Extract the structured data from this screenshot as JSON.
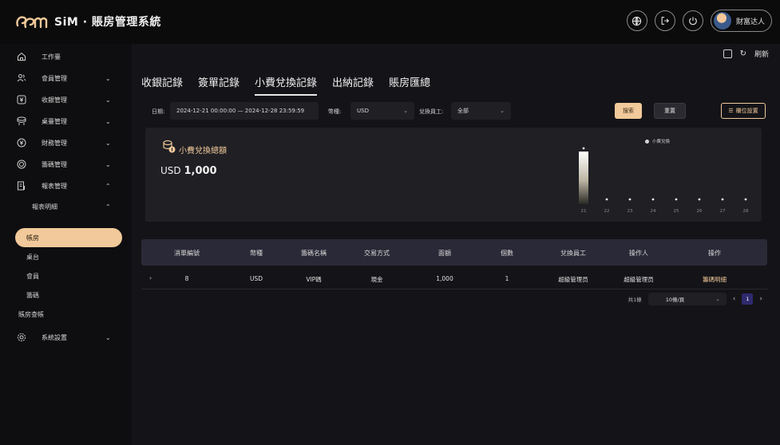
{
  "app": {
    "title": "SiM · 賬房管理系統",
    "user_name": "財富达人"
  },
  "sidebar": {
    "items": [
      {
        "label": "工作臺",
        "icon": "home-icon"
      },
      {
        "label": "會員管理",
        "icon": "user-group-icon"
      },
      {
        "label": "收銀管理",
        "icon": "cashier-icon"
      },
      {
        "label": "桌臺管理",
        "icon": "table-icon"
      },
      {
        "label": "財務管理",
        "icon": "finance-icon"
      },
      {
        "label": "籌碼管理",
        "icon": "chip-icon"
      },
      {
        "label": "報表管理",
        "icon": "report-icon"
      },
      {
        "label": "系統設置",
        "icon": "settings-icon"
      }
    ],
    "report_group": "報表明細",
    "report_subitems": [
      "帳房",
      "桌台",
      "會員",
      "籌碼"
    ],
    "account_reconcile": "賬房查帳"
  },
  "main": {
    "refresh_label": "刷新",
    "tabs": [
      "收銀記錄",
      "簽單記錄",
      "小費兌換記錄",
      "出納記錄",
      "賬房匯總"
    ],
    "active_tab_index": 2,
    "filters": {
      "date_label": "日期:",
      "date_range": "2024-12-21 00:00:00 — 2024-12-28 23:59:59",
      "currency_label": "幣種:",
      "currency_value": "USD",
      "staff_label": "兌換員工:",
      "staff_value": "全部",
      "search_label": "搜索",
      "reset_label": "重置",
      "columns_label": "欄位設置"
    },
    "summary": {
      "title": "小費兌換總額",
      "currency": "USD",
      "total": "1,000",
      "legend": "小費兌換"
    },
    "table": {
      "headers": [
        "消單編號",
        "幣種",
        "籌碼名稱",
        "交易方式",
        "面額",
        "個數",
        "兌換員工",
        "操作人",
        "操作"
      ],
      "rows": [
        [
          "8",
          "USD",
          "VIP碼",
          "現金",
          "1,000",
          "1",
          "超級管理员",
          "超級管理员",
          "籌碼明細"
        ]
      ]
    },
    "pager": {
      "total": "共1條",
      "page_size": "10條/頁",
      "current_page": "1"
    }
  },
  "chart_data": {
    "type": "bar",
    "categories": [
      "21",
      "22",
      "23",
      "24",
      "25",
      "26",
      "27",
      "28"
    ],
    "series": [
      {
        "name": "小費兌換",
        "values": [
          1000,
          0,
          0,
          0,
          0,
          0,
          0,
          0
        ]
      }
    ],
    "ylim": [
      0,
      1000
    ],
    "grid": false,
    "legend_position": "top-right"
  }
}
